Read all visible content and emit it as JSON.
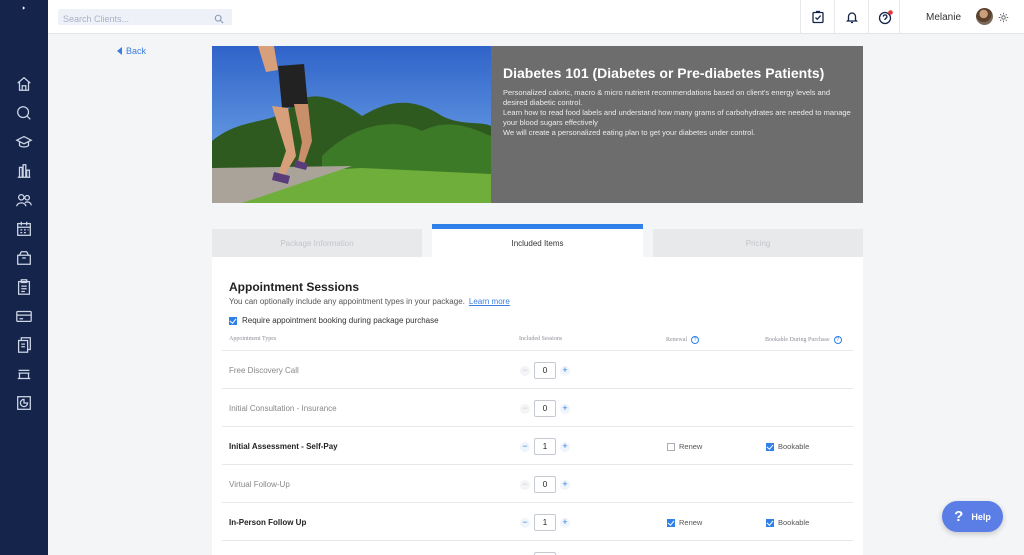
{
  "topbar": {
    "search_placeholder": "Search Clients...",
    "user_name": "Melanie"
  },
  "back_label": "Back",
  "hero": {
    "title": "Diabetes 101 (Diabetes or Pre-diabetes Patients)",
    "description": [
      "Personalized caloric, macro & micro nutrient recommendations based on client's energy levels and desired diabetic control.",
      "Learn how to read food labels and understand how many grams of carbohydrates are needed to manage your blood sugars effectively",
      "We will create a personalized eating plan to get your diabetes under control."
    ]
  },
  "tabs": [
    {
      "label": "Package Information",
      "active": false
    },
    {
      "label": "Included Items",
      "active": true
    },
    {
      "label": "Pricing",
      "active": false
    }
  ],
  "section": {
    "title": "Appointment Sessions",
    "subtitle": "You can optionally include any appointment types in your package.",
    "learn_more": "Learn more",
    "require_booking_label": "Require appointment booking during package purchase",
    "require_booking_checked": true
  },
  "columns": {
    "types": "Appointment Types",
    "sessions": "Included Sessions",
    "renewal": "Renewal",
    "bookable": "Bookable During Purchase",
    "help_glyph": "?"
  },
  "rows": [
    {
      "name": "Free Discovery Call",
      "value": "0",
      "active": false,
      "renew": null,
      "bookable": null
    },
    {
      "name": "Initial Consultation - Insurance",
      "value": "0",
      "active": false,
      "renew": null,
      "bookable": null
    },
    {
      "name": "Initial Assessment - Self-Pay",
      "value": "1",
      "active": true,
      "renew": false,
      "bookable": true
    },
    {
      "name": "Virtual Follow-Up",
      "value": "0",
      "active": false,
      "renew": null,
      "bookable": null
    },
    {
      "name": "In-Person Follow Up",
      "value": "1",
      "active": true,
      "renew": true,
      "bookable": true
    },
    {
      "name": "",
      "value": "",
      "active": false,
      "renew": null,
      "bookable": null
    }
  ],
  "row_labels": {
    "renew": "Renew",
    "bookable": "Bookable",
    "minus": "−",
    "plus": "+"
  },
  "help": {
    "glyph": "?",
    "label": "Help"
  },
  "colors": {
    "sidebar": "#14244a",
    "accent": "#2f80e8",
    "hero_bg": "#6d6d6d",
    "help": "#5a7ee6"
  }
}
